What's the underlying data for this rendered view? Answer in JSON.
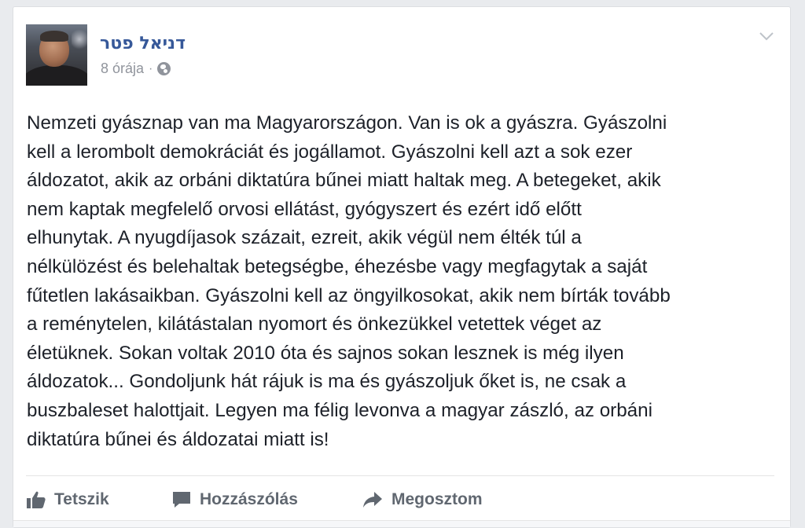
{
  "post": {
    "author_name": "דניאל פטר",
    "timestamp": "8 órája",
    "separator": "·",
    "privacy_icon": "globe-icon",
    "menu_icon": "chevron-down-icon",
    "text": "Nemzeti gyásznap van ma Magyarországon. Van is ok a gyászra. Gyászolni\nkell a lerombolt demokráciát és jogállamot. Gyászolni kell azt a sok ezer\náldozatot, akik az orbáni diktatúra bűnei miatt haltak meg. A betegeket, akik\nnem kaptak megfelelő orvosi ellátást, gyógyszert és ezért idő előtt\nelhunytak. A nyugdíjasok százait, ezreit, akik végül nem élték túl a\nnélkülözést és belehaltak betegségbe, éhezésbe vagy megfagytak a saját\nfűtetlen lakásaikban. Gyászolni kell az öngyilkosokat, akik nem bírták tovább\na reménytelen, kilátástalan nyomort és önkezükkel vetettek véget az\néletüknek. Sokan voltak 2010 óta és sajnos sokan lesznek is még ilyen\náldozatok... Gondoljunk hát rájuk is ma és gyászoljuk őket is, ne csak a\nbuszbaleset halottjait. Legyen ma félig levonva a magyar zászló, az orbáni\ndiktatúra bűnei és áldozatai miatt is!"
  },
  "actions": {
    "like_label": "Tetszik",
    "like_icon": "thumbs-up-icon",
    "comment_label": "Hozzászólás",
    "comment_icon": "comment-icon",
    "share_label": "Megosztom",
    "share_icon": "share-arrow-icon"
  },
  "colors": {
    "author": "#365899",
    "meta": "#90949c",
    "text": "#1d2129",
    "action": "#606770",
    "background": "#e9ebee"
  }
}
